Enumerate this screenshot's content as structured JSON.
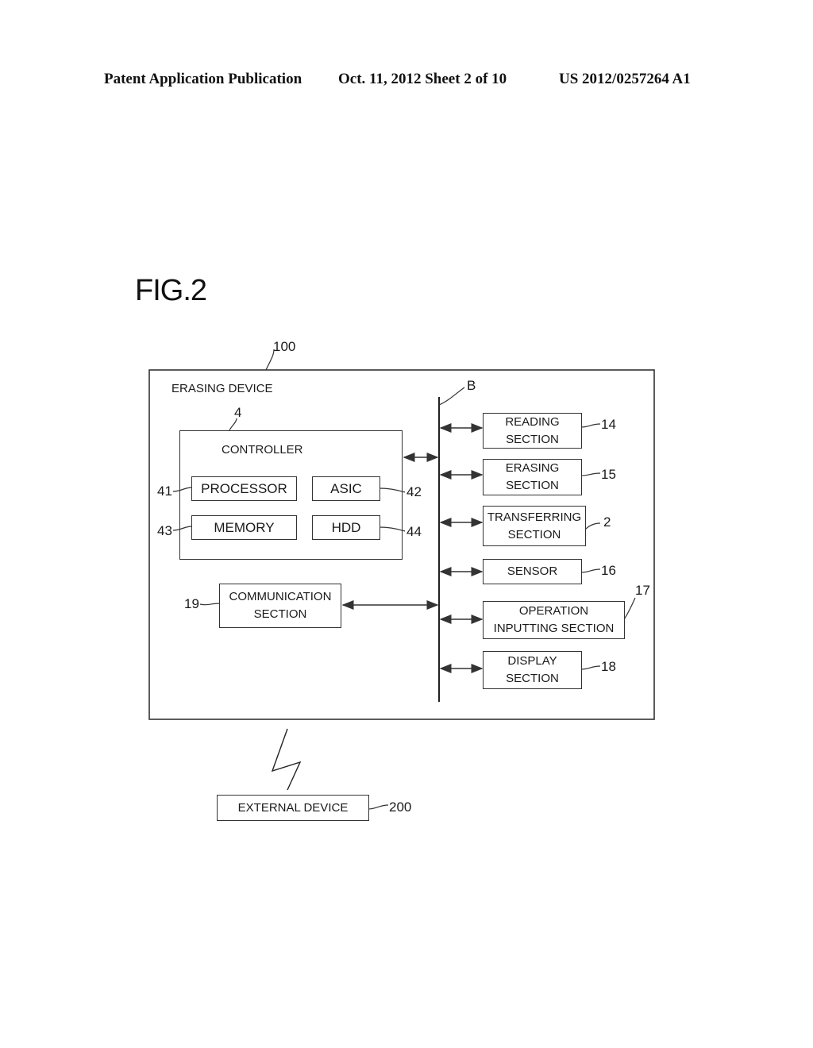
{
  "header": {
    "publication": "Patent Application Publication",
    "date_sheet": "Oct. 11, 2012   Sheet 2 of 10",
    "number": "US 2012/0257264 A1"
  },
  "figure": {
    "title": "FIG.2"
  },
  "device": {
    "ref": "100",
    "label": "ERASING DEVICE",
    "bus_ref": "B",
    "controller": {
      "ref": "4",
      "label": "CONTROLLER",
      "components": [
        {
          "ref": "41",
          "label": "PROCESSOR"
        },
        {
          "ref": "42",
          "label": "ASIC"
        },
        {
          "ref": "43",
          "label": "MEMORY"
        },
        {
          "ref": "44",
          "label": "HDD"
        }
      ]
    },
    "communication": {
      "ref": "19",
      "line1": "COMMUNICATION",
      "line2": "SECTION"
    },
    "sections": [
      {
        "ref": "14",
        "line1": "READING",
        "line2": "SECTION"
      },
      {
        "ref": "15",
        "line1": "ERASING",
        "line2": "SECTION"
      },
      {
        "ref": "2",
        "line1": "TRANSFERRING",
        "line2": "SECTION"
      },
      {
        "ref": "16",
        "line1": "SENSOR",
        "line2": ""
      },
      {
        "ref": "17",
        "line1": "OPERATION",
        "line2": "INPUTTING SECTION"
      },
      {
        "ref": "18",
        "line1": "DISPLAY",
        "line2": "SECTION"
      }
    ]
  },
  "external": {
    "ref": "200",
    "label": "EXTERNAL DEVICE"
  }
}
